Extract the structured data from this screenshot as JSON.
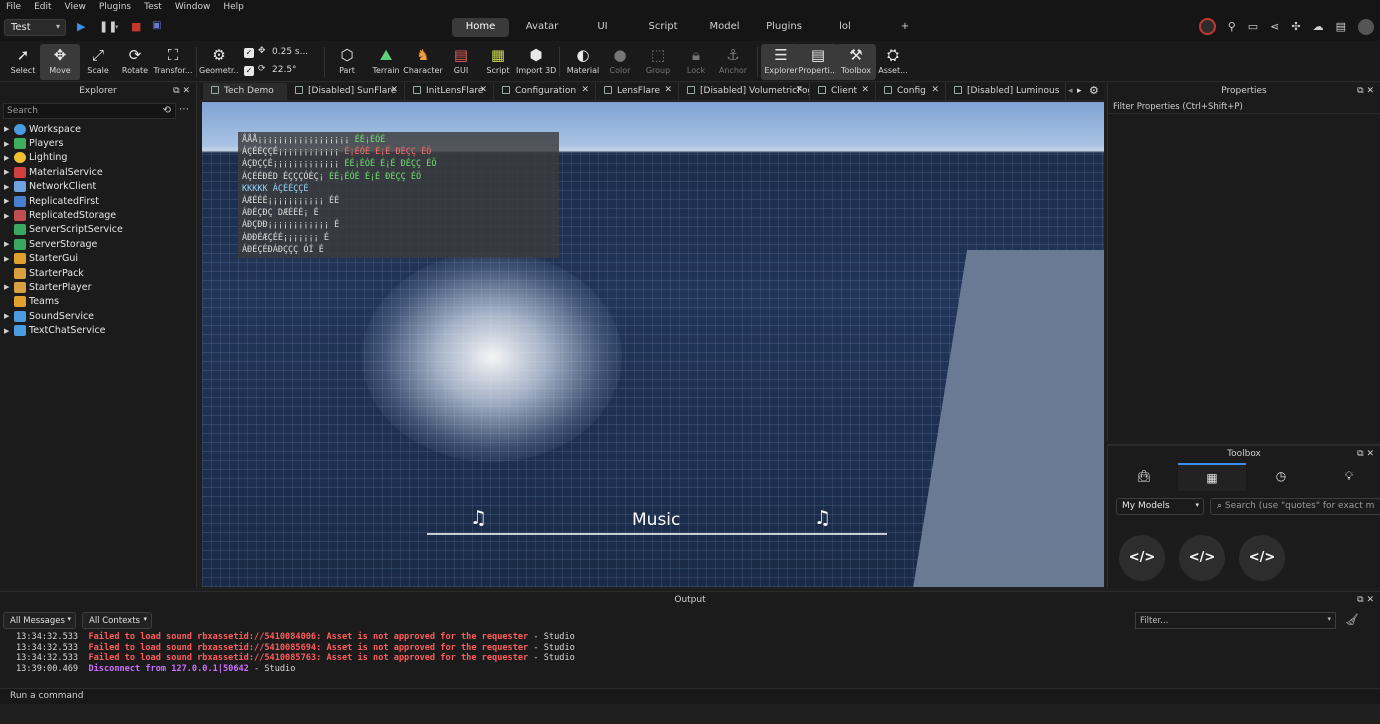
{
  "menu": [
    "File",
    "Edit",
    "View",
    "Plugins",
    "Test",
    "Window",
    "Help"
  ],
  "topbar": {
    "mode": "Test",
    "play_icon": "play-icon",
    "pause_icon": "pause-icon",
    "stop_icon": "stop-icon",
    "tabs": [
      "Home",
      "Avatar",
      "UI",
      "Script",
      "Model",
      "Plugins",
      "lol",
      "+"
    ],
    "active_tab": "Home"
  },
  "toolbar": {
    "tools": [
      {
        "label": "Select",
        "icon": "cursor-icon"
      },
      {
        "label": "Move",
        "icon": "move-icon"
      },
      {
        "label": "Scale",
        "icon": "scale-icon"
      },
      {
        "label": "Rotate",
        "icon": "rotate-icon"
      },
      {
        "label": "Transfor...",
        "icon": "transform-icon"
      },
      {
        "label": "Geometr...",
        "icon": "geometry-icon"
      },
      {
        "label": "Part",
        "icon": "part-icon"
      },
      {
        "label": "Terrain",
        "icon": "terrain-icon"
      },
      {
        "label": "Character",
        "icon": "character-icon"
      },
      {
        "label": "GUI",
        "icon": "gui-icon"
      },
      {
        "label": "Script",
        "icon": "script-icon"
      },
      {
        "label": "Import 3D",
        "icon": "import-icon"
      },
      {
        "label": "Material",
        "icon": "material-icon"
      },
      {
        "label": "Color",
        "icon": "color-icon"
      },
      {
        "label": "Group",
        "icon": "group-icon"
      },
      {
        "label": "Lock",
        "icon": "lock-icon"
      },
      {
        "label": "Anchor",
        "icon": "anchor-icon"
      },
      {
        "label": "Explorer",
        "icon": "explorer-icon"
      },
      {
        "label": "Properti...",
        "icon": "properties-icon"
      },
      {
        "label": "Toolbox",
        "icon": "toolbox-icon"
      },
      {
        "label": "Asset...",
        "icon": "asset-icon"
      }
    ],
    "move_snap": "0.25 s...",
    "rotate_snap": "22.5°"
  },
  "explorer": {
    "title": "Explorer",
    "search_placeholder": "Search",
    "items": [
      {
        "label": "Workspace",
        "color": "#4a9be0",
        "expandable": true
      },
      {
        "label": "Players",
        "color": "#3fae5c",
        "expandable": true
      },
      {
        "label": "Lighting",
        "color": "#f0c030",
        "expandable": true
      },
      {
        "label": "MaterialService",
        "color": "#d04040",
        "expandable": true
      },
      {
        "label": "NetworkClient",
        "color": "#6fa0e0",
        "expandable": true
      },
      {
        "label": "ReplicatedFirst",
        "color": "#4a7fd0",
        "expandable": true
      },
      {
        "label": "ReplicatedStorage",
        "color": "#c05050",
        "expandable": true
      },
      {
        "label": "ServerScriptService",
        "color": "#3aa860",
        "expandable": false
      },
      {
        "label": "ServerStorage",
        "color": "#3aa860",
        "expandable": true
      },
      {
        "label": "StarterGui",
        "color": "#e0a030",
        "expandable": true
      },
      {
        "label": "StarterPack",
        "color": "#d8a040",
        "expandable": false
      },
      {
        "label": "StarterPlayer",
        "color": "#d8a040",
        "expandable": true
      },
      {
        "label": "Teams",
        "color": "#e0a030",
        "expandable": false
      },
      {
        "label": "SoundService",
        "color": "#4a9be0",
        "expandable": true
      },
      {
        "label": "TextChatService",
        "color": "#4a9be0",
        "expandable": true
      }
    ]
  },
  "doctabs": [
    {
      "label": "Tech Demo",
      "active": true
    },
    {
      "label": "[Disabled] SunFlare",
      "active": false
    },
    {
      "label": "InitLensFlare",
      "active": false
    },
    {
      "label": "Configuration",
      "active": false
    },
    {
      "label": "LensFlare",
      "active": false
    },
    {
      "label": "[Disabled] VolumetricFog",
      "active": false
    },
    {
      "label": "Client",
      "active": false
    },
    {
      "label": "Config",
      "active": false
    },
    {
      "label": "[Disabled] Luminous",
      "active": false
    }
  ],
  "viewport": {
    "debug_rows": [
      {
        "a": "ÅÅÅ¡¡¡¡¡¡¡¡¡¡¡¡¡¡¡¡¡¡ ",
        "b": "ÉÉ¡ÉÓÉ",
        "cls": "g"
      },
      {
        "a": "ÁÇÉÉÇÇÉ¡¡¡¡¡¡¡¡¡¡¡¡ ",
        "b": "É¡ÉÓÉ É¡É ÐÉÇÇ ÉÖ",
        "cls": "r"
      },
      {
        "a": "ÁÇÐÇÇÉ¡¡¡¡¡¡¡¡¡¡¡¡¡ ",
        "b": "ÉÉ¡ÉÓÉ É¡É ÐÉÇÇ ÉÖ",
        "cls": "g"
      },
      {
        "a": "ÁÇÉÉÐÉD ÉÇÇÇÓÉÇ¡ ",
        "b": "ÉÉ¡ÉÓÉ É¡É ÐÉÇÇ ÉÖ",
        "cls": "g"
      },
      {
        "a": "KKKKK ",
        "b": "ÁÇÉÉÇÇÉ",
        "cls": "c"
      },
      {
        "a": "ÁÆÉÉÉ¡¡¡¡¡¡¡¡¡¡¡ ",
        "b": "ÉÉ",
        "cls": ""
      },
      {
        "a": "ÁÐÉÇÐÇ DÆÉÉÉ¡ ",
        "b": "É",
        "cls": ""
      },
      {
        "a": "ÁÐÇÐÐ¡¡¡¡¡¡¡¡¡¡¡¡ ",
        "b": "É",
        "cls": ""
      },
      {
        "a": "ÁÐÐÉÆÇÉÉ¡¡¡¡¡¡¡ ",
        "b": "É",
        "cls": ""
      },
      {
        "a": "ÁÐÉÇÉÐÁÐÇÇÇ ÓÍ ",
        "b": "É",
        "cls": ""
      }
    ],
    "music_label": "Music",
    "note_icon": "music-note-icon"
  },
  "properties": {
    "title": "Properties",
    "filter_placeholder": "Filter Properties (Ctrl+Shift+P)"
  },
  "toolbox": {
    "title": "Toolbox",
    "tabs": [
      "shop-icon",
      "grid-icon",
      "clock-icon",
      "bulb-icon"
    ],
    "category": "My Models",
    "search_placeholder": "Search (use \"quotes\" for exact m",
    "code_button_label": "</>"
  },
  "output": {
    "title": "Output",
    "messages_filter": "All Messages",
    "contexts_filter": "All Contexts",
    "filter_placeholder": "Filter...",
    "lines": [
      {
        "time": "13:34:32.533",
        "text": "Failed to load sound rbxassetid://5410084006: Asset is not approved for the requester",
        "suffix": "  -  Studio",
        "level": "err"
      },
      {
        "time": "13:34:32.533",
        "text": "Failed to load sound rbxassetid://5410085694: Asset is not approved for the requester",
        "suffix": "  -  Studio",
        "level": "err"
      },
      {
        "time": "13:34:32.533",
        "text": "Failed to load sound rbxassetid://5410085763: Asset is not approved for the requester",
        "suffix": "  -  Studio",
        "level": "err"
      },
      {
        "time": "13:39:00.469",
        "text": "Disconnect from 127.0.0.1|50642",
        "suffix": "  -  Studio",
        "level": "warn"
      }
    ],
    "command_placeholder": "Run a command"
  }
}
